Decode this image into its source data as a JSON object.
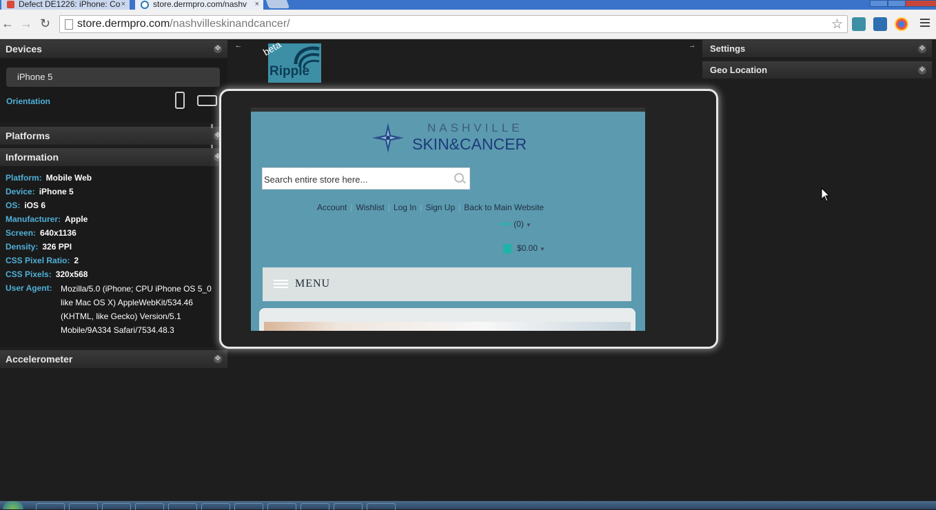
{
  "browser": {
    "tabs": [
      {
        "title": "Defect DE1226: iPhone: Co",
        "active": false
      },
      {
        "title": "store.dermpro.com/nashv",
        "active": true
      }
    ],
    "url_host": "store.dermpro.com",
    "url_path": "/nashvilleskinandcancer/",
    "close_glyph": "×"
  },
  "ripple": {
    "logo_text": "Ripple",
    "beta_label": "beta",
    "collapse_left": "←",
    "collapse_right": "→"
  },
  "left_panels": {
    "devices": {
      "title": "Devices",
      "selected_device": "iPhone 5",
      "orientation_label": "Orientation"
    },
    "platforms": {
      "title": "Platforms"
    },
    "information": {
      "title": "Information",
      "rows": [
        {
          "key": "Platform:",
          "value": "Mobile Web"
        },
        {
          "key": "Device:",
          "value": "iPhone 5"
        },
        {
          "key": "OS:",
          "value": "iOS 6"
        },
        {
          "key": "Manufacturer:",
          "value": "Apple"
        },
        {
          "key": "Screen:",
          "value": "640x1136"
        },
        {
          "key": "Density:",
          "value": "326 PPI"
        },
        {
          "key": "CSS Pixel Ratio:",
          "value": "2"
        },
        {
          "key": "CSS Pixels:",
          "value": "320x568"
        }
      ],
      "user_agent_key": "User Agent:",
      "user_agent_value": "Mozilla/5.0 (iPhone; CPU iPhone OS 5_0 like Mac OS X) AppleWebKit/534.46 (KHTML, like Gecko) Version/5.1 Mobile/9A334 Safari/7534.48.3"
    },
    "accelerometer": {
      "title": "Accelerometer"
    }
  },
  "right_panels": {
    "settings": {
      "title": "Settings"
    },
    "geo_location": {
      "title": "Geo Location"
    }
  },
  "site": {
    "logo_top": "NASHVILLE",
    "logo_bottom": "SKIN&CANCER",
    "search_placeholder": "Search entire store here...",
    "links": [
      "Account",
      "Wishlist",
      "Log In",
      "Sign Up",
      "Back to Main Website"
    ],
    "compare_count": "(0)",
    "cart_total": "$0.00",
    "menu_label": "MENU"
  },
  "colors": {
    "panel_label": "#4fb0d8",
    "site_bg": "#5c9ab0",
    "brand_navy": "#1d3c78",
    "cart_teal": "#1fb2a6"
  }
}
